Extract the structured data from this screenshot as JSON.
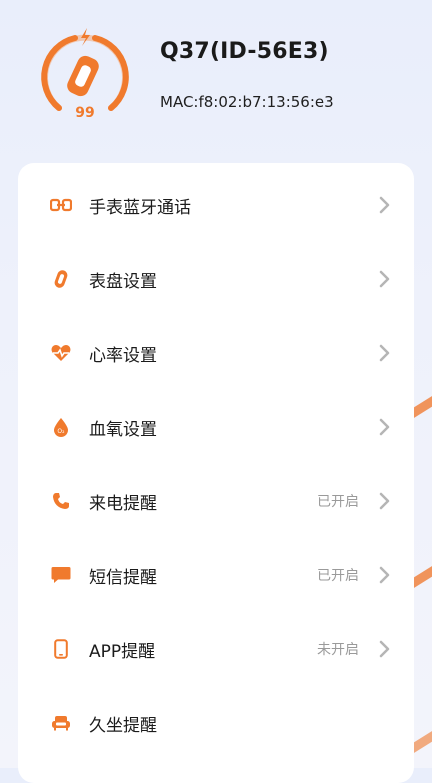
{
  "device": {
    "name": "Q37(ID-56E3)",
    "mac": "MAC:f8:02:b7:13:56:e3",
    "battery": "99",
    "battery_level": 0.99
  },
  "colors": {
    "accent": "#f07a2d",
    "text": "#1b1b1b",
    "muted": "#9a9a9a",
    "chevron": "#b5b5b5"
  },
  "menu": [
    {
      "label": "手表蓝牙通话",
      "status": "",
      "icon": "link-icon"
    },
    {
      "label": "表盘设置",
      "status": "",
      "icon": "watch-face-icon"
    },
    {
      "label": "心率设置",
      "status": "",
      "icon": "heart-rate-icon"
    },
    {
      "label": "血氧设置",
      "status": "",
      "icon": "blood-oxygen-icon"
    },
    {
      "label": "来电提醒",
      "status": "已开启",
      "icon": "phone-icon"
    },
    {
      "label": "短信提醒",
      "status": "已开启",
      "icon": "message-icon"
    },
    {
      "label": "APP提醒",
      "status": "未开启",
      "icon": "smartphone-icon"
    },
    {
      "label": "久坐提醒",
      "status": "",
      "icon": "sofa-icon"
    }
  ]
}
